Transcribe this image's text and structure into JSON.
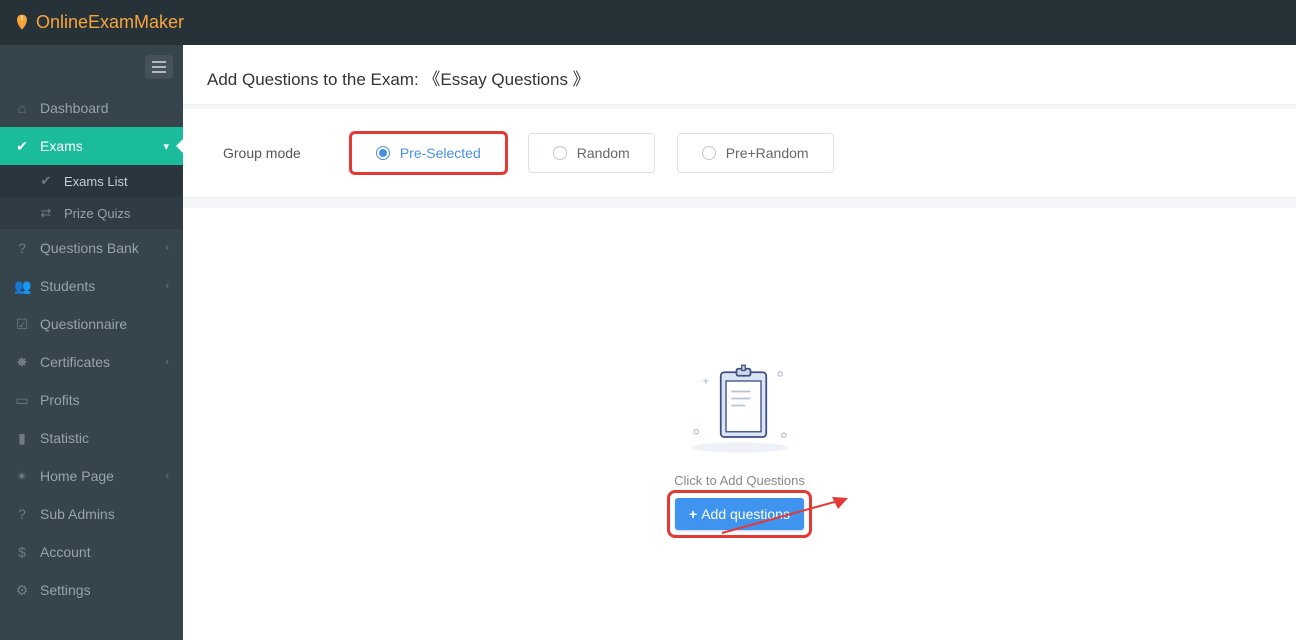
{
  "brand": "OnlineExamMaker",
  "page_title_prefix": "Add Questions to the Exam:",
  "page_title_name": "《Essay Questions 》",
  "group_mode_label": "Group mode",
  "group_modes": {
    "pre": "Pre-Selected",
    "random": "Random",
    "pre_random": "Pre+Random"
  },
  "empty_state_text": "Click to Add Questions",
  "add_button_label": "Add questions",
  "sidebar": {
    "dashboard": "Dashboard",
    "exams": "Exams",
    "exams_list": "Exams List",
    "prize_quizs": "Prize Quizs",
    "questions_bank": "Questions Bank",
    "students": "Students",
    "questionnaire": "Questionnaire",
    "certificates": "Certificates",
    "profits": "Profits",
    "statistic": "Statistic",
    "home_page": "Home Page",
    "sub_admins": "Sub Admins",
    "account": "Account",
    "settings": "Settings"
  }
}
